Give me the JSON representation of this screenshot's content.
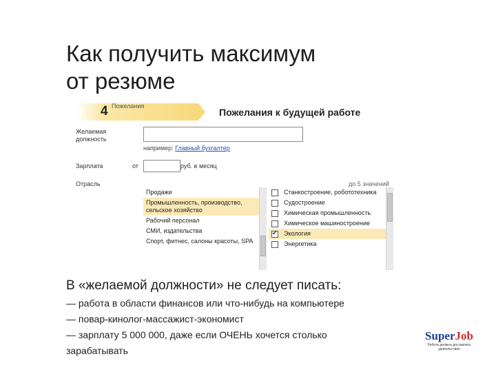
{
  "slide": {
    "title": "Как получить максимум\nот резюме"
  },
  "form": {
    "step_number": "4",
    "step_label": "Пожелания",
    "section_title": "Пожелания к будущей работе",
    "position_label": "Желаемая\nдолжность",
    "position_value": "",
    "position_hint_prefix": "например:",
    "position_hint_example": "Главный бухгалтер",
    "salary_label": "Зарплата",
    "salary_from": "от",
    "salary_value": "",
    "salary_unit": "руб. в месяц",
    "industry_label": "Отрасль",
    "industry_note": "до 5 значений",
    "industries": [
      {
        "label": "Продажи",
        "selected": false
      },
      {
        "label": "Промышленность, производство, сельское хозяйство",
        "selected": true
      },
      {
        "label": "Рабочий персонал",
        "selected": false
      },
      {
        "label": "СМИ, издательства",
        "selected": false
      },
      {
        "label": "Спорт, фитнес, салоны красоты, SPA",
        "selected": false
      }
    ],
    "subindustries": [
      {
        "label": "Станкостроение, робототехника",
        "checked": false,
        "selected": false
      },
      {
        "label": "Судостроение",
        "checked": false,
        "selected": false
      },
      {
        "label": "Химическая промышленность",
        "checked": false,
        "selected": false
      },
      {
        "label": "Химическое машиностроение",
        "checked": false,
        "selected": false
      },
      {
        "label": "Экология",
        "checked": true,
        "selected": true
      },
      {
        "label": "Энергетика",
        "checked": false,
        "selected": false
      }
    ]
  },
  "notes": {
    "heading": "В «желаемой должности» не следует писать:",
    "bullets": [
      "— работа в области финансов или что-нибудь на компьютере",
      "— повар-кинолог-массажист-экономист",
      "— зарплату 5 000 000, даже если ОЧЕНЬ хочется столько",
      "зарабатывать"
    ]
  },
  "logo": {
    "super": "Super",
    "job": "Job",
    "tagline": "Работа должна доставлять удовольствие"
  },
  "colors": {
    "accent_yellow": "#fbeab7",
    "arrow_yellow": "#f7d97a",
    "logo_blue": "#1c3f8f",
    "logo_red": "#d22a2a"
  }
}
